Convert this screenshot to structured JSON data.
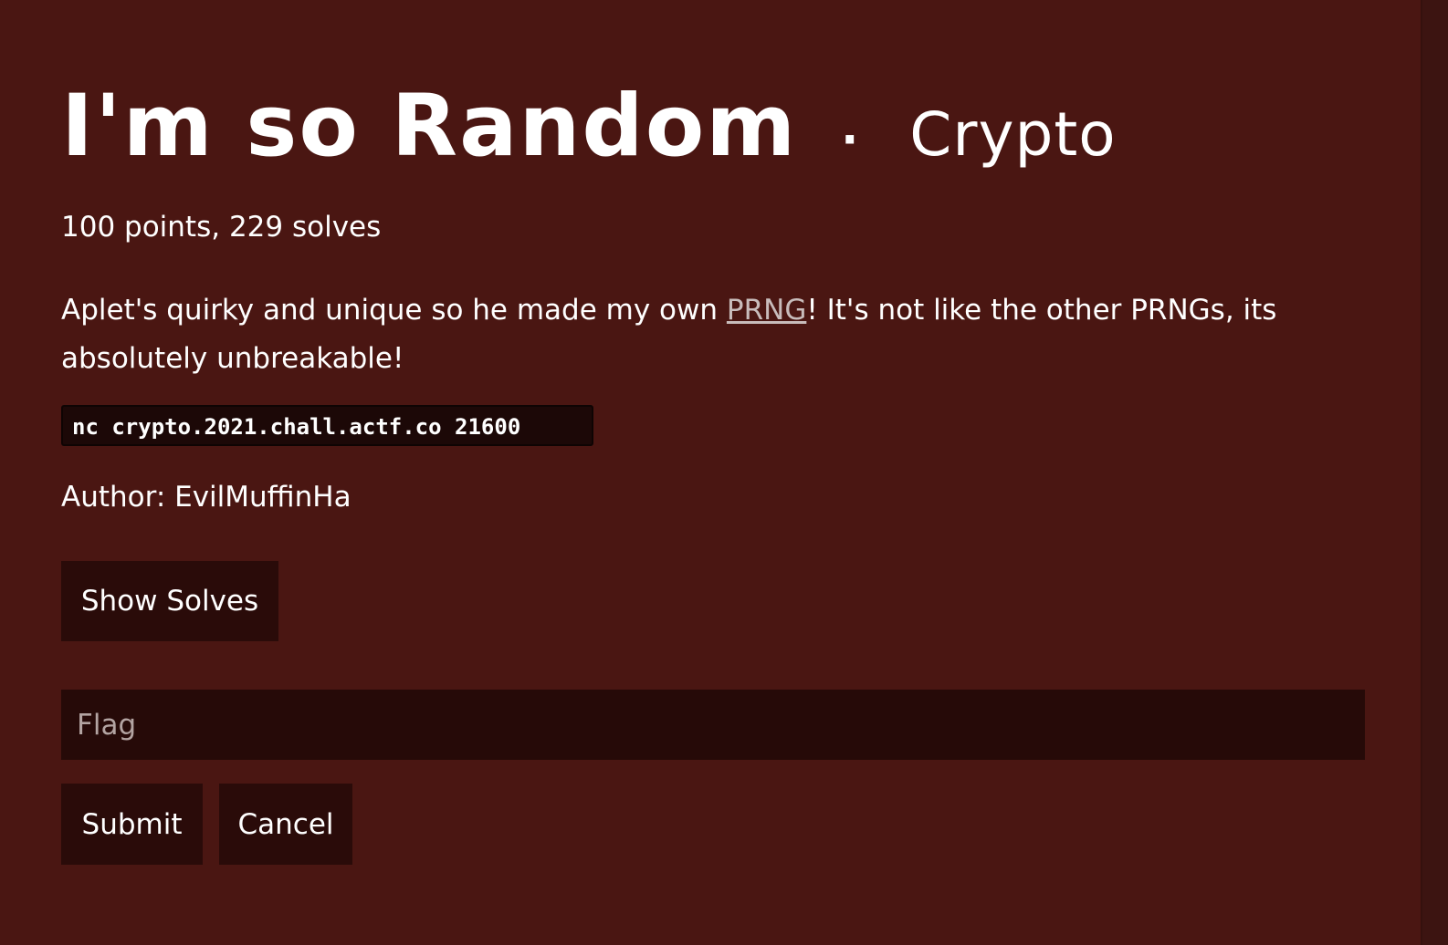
{
  "challenge": {
    "title": "I'm so Random",
    "separator": "·",
    "category": "Crypto",
    "meta": "100 points, 229 solves",
    "description": {
      "before_link": "Aplet's quirky and unique so he made my own ",
      "link_text": "PRNG",
      "after_link": "! It's not like the other PRNGs, its absolutely unbreakable!"
    },
    "command": "nc crypto.2021.chall.actf.co 21600",
    "author": "Author: EvilMuffinHa"
  },
  "buttons": {
    "show_solves": "Show Solves",
    "submit": "Submit",
    "cancel": "Cancel"
  },
  "flag_input": {
    "placeholder": "Flag",
    "value": ""
  },
  "colors": {
    "background": "#4a1612",
    "button_bg": "#2a0b09",
    "input_bg": "#260a08",
    "code_bg": "#1c0807",
    "link": "#c8bcbb"
  }
}
